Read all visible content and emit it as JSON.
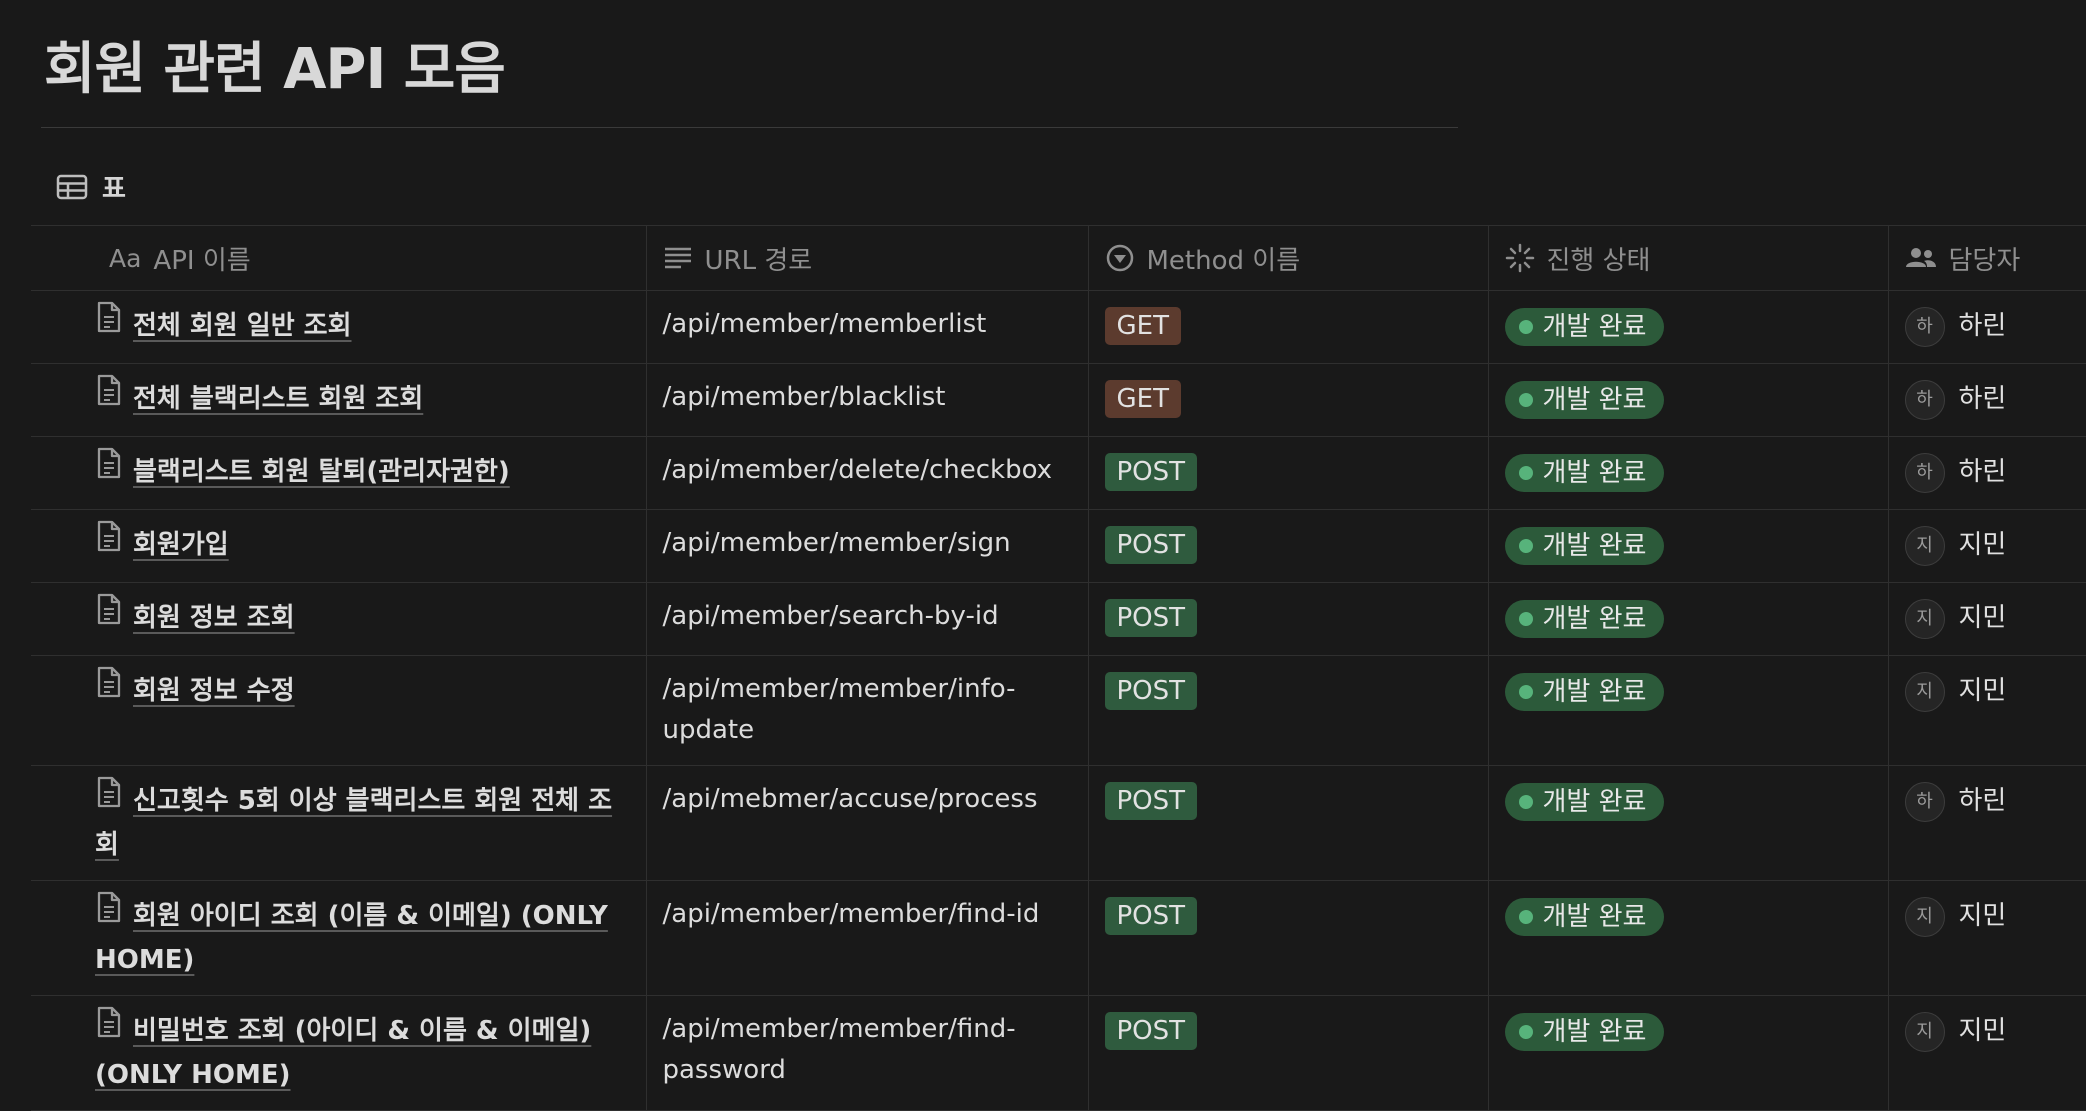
{
  "page": {
    "title": "회원 관련 API 모음"
  },
  "view": {
    "tab_label": "표"
  },
  "columns": [
    {
      "label": "API 이름",
      "icon": "text-type-icon"
    },
    {
      "label": "URL 경로",
      "icon": "lines-icon"
    },
    {
      "label": "Method 이름",
      "icon": "select-circle-icon"
    },
    {
      "label": "진행 상태",
      "icon": "status-spinner-icon"
    },
    {
      "label": "담당자",
      "icon": "people-icon"
    }
  ],
  "rows": [
    {
      "name": "전체 회원 일반 조회",
      "url": "/api/member/memberlist",
      "method": "GET",
      "status": "개발 완료",
      "assignee_initial": "하",
      "assignee": "하린"
    },
    {
      "name": "전체 블랙리스트 회원 조회",
      "url": "/api/member/blacklist",
      "method": "GET",
      "status": "개발 완료",
      "assignee_initial": "하",
      "assignee": "하린"
    },
    {
      "name": "블랙리스트 회원 탈퇴(관리자권한)",
      "url": "/api/member/delete/checkbox",
      "method": "POST",
      "status": "개발 완료",
      "assignee_initial": "하",
      "assignee": "하린"
    },
    {
      "name": "회원가입",
      "url": "/api/member/member/sign",
      "method": "POST",
      "status": "개발 완료",
      "assignee_initial": "지",
      "assignee": "지민"
    },
    {
      "name": "회원 정보 조회",
      "url": "/api/member/search-by-id",
      "method": "POST",
      "status": "개발 완료",
      "assignee_initial": "지",
      "assignee": "지민"
    },
    {
      "name": "회원 정보 수정",
      "url": "/api/member/member/info-update",
      "method": "POST",
      "status": "개발 완료",
      "assignee_initial": "지",
      "assignee": "지민"
    },
    {
      "name": "신고횟수 5회 이상 블랙리스트 회원 전체 조회",
      "url": "/api/mebmer/accuse/process",
      "method": "POST",
      "status": "개발 완료",
      "assignee_initial": "하",
      "assignee": "하린"
    },
    {
      "name": "회원 아이디 조회 (이름 & 이메일) (ONLY HOME)",
      "url": "/api/member/member/find-id",
      "method": "POST",
      "status": "개발 완료",
      "assignee_initial": "지",
      "assignee": "지민"
    },
    {
      "name": "비밀번호 조회 (아이디 & 이름 & 이메일) (ONLY HOME)",
      "url": "/api/member/member/find-password",
      "method": "POST",
      "status": "개발 완료",
      "assignee_initial": "지",
      "assignee": "지민"
    }
  ],
  "colors": {
    "get_badge": "#5c3b2e",
    "post_badge": "#2f5b3e",
    "status_badge": "#2c5a3a",
    "status_dot": "#57b37b"
  }
}
